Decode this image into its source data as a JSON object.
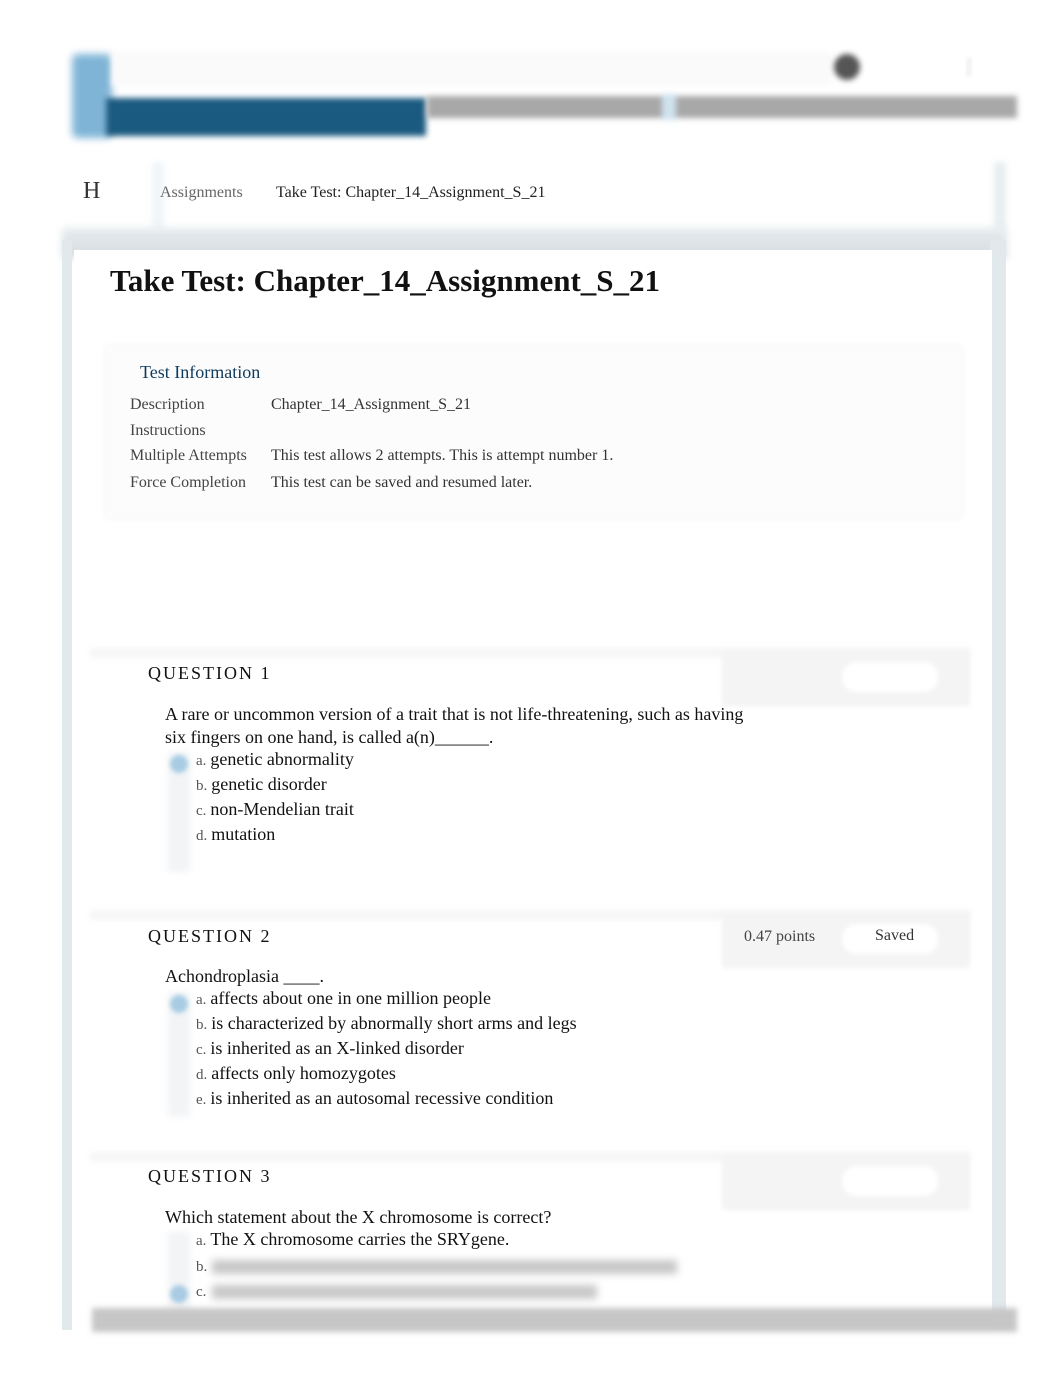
{
  "header": {
    "brand_color": "#1b5a80",
    "accent_color": "#7fb4d6"
  },
  "breadcrumb": {
    "home_letter": "H",
    "items": [
      "Assignments",
      "Take Test: Chapter_14_Assignment_S_21"
    ]
  },
  "page": {
    "title": "Take Test: Chapter_14_Assignment_S_21"
  },
  "test_info": {
    "heading": "Test Information",
    "rows": [
      {
        "label": "Description",
        "value": "Chapter_14_Assignment_S_21"
      },
      {
        "label": "Instructions",
        "value": ""
      },
      {
        "label": "Multiple Attempts",
        "value": "This test allows 2 attempts. This is attempt number 1."
      },
      {
        "label": "Force Completion",
        "value": "This test can be saved and resumed later."
      }
    ]
  },
  "questions": [
    {
      "title": "QUESTION 1",
      "points": "",
      "status": "",
      "text": "A rare or uncommon version of a trait that is not life-threatening, such as having six fingers on one hand, is called a(n)______.",
      "selected": "a",
      "options": [
        {
          "letter": "a.",
          "text": "genetic abnormality"
        },
        {
          "letter": "b.",
          "text": "genetic disorder"
        },
        {
          "letter": "c.",
          "text": "non-Mendelian trait"
        },
        {
          "letter": "d.",
          "text": "mutation"
        }
      ]
    },
    {
      "title": "QUESTION 2",
      "points": "0.47 points",
      "status": "Saved",
      "text": "Achondroplasia ____.",
      "selected": "a",
      "options": [
        {
          "letter": "a.",
          "text": "affects about one in one million people"
        },
        {
          "letter": "b.",
          "text": "is characterized by abnormally short arms and legs"
        },
        {
          "letter": "c.",
          "text": "is inherited as an X-linked disorder"
        },
        {
          "letter": "d.",
          "text": "affects only homozygotes"
        },
        {
          "letter": "e.",
          "text": "is inherited as an autosomal recessive condition"
        }
      ]
    },
    {
      "title": "QUESTION 3",
      "points": "",
      "status": "",
      "text": "Which statement about the X chromosome is correct?",
      "selected": "c",
      "options": [
        {
          "letter": "a.",
          "text": "The X chromosome carries the SRYgene."
        },
        {
          "letter": "b.",
          "text": ""
        },
        {
          "letter": "c.",
          "text": ""
        }
      ]
    }
  ]
}
